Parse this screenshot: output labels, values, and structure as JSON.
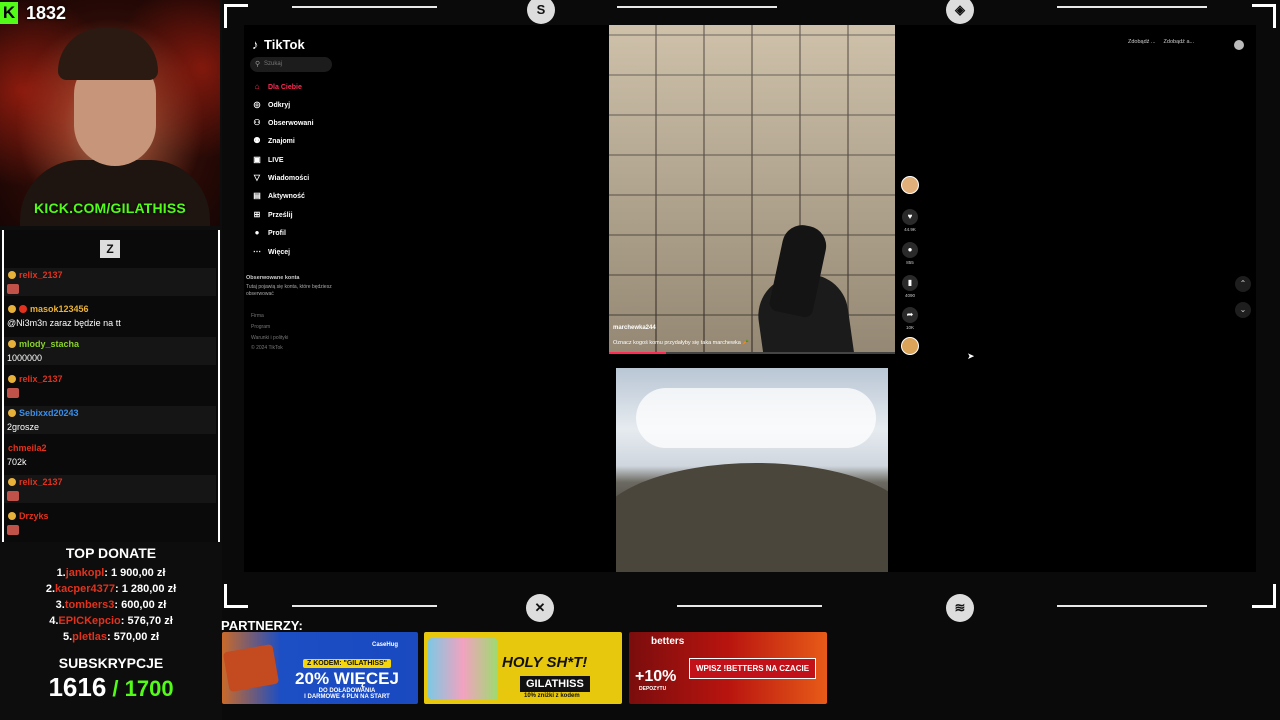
{
  "stream": {
    "viewer_count": "1832",
    "kick_url": "KICK.COM/GILATHISS"
  },
  "chat": {
    "messages": [
      {
        "user": "relix_2137",
        "text": "",
        "color": "#e2321d"
      },
      {
        "user": "masok123456",
        "text": "@Ni3m3n zaraz będzie na tt",
        "color": "#e8b13a"
      },
      {
        "user": "mlody_stacha",
        "text": "1000000",
        "color": "#8bd12b"
      },
      {
        "user": "relix_2137",
        "text": "",
        "color": "#e2321d"
      },
      {
        "user": "Sebixxd20243",
        "text": "2grosze",
        "color": "#3a8ee8"
      },
      {
        "user": "chmeila2",
        "text": "702k",
        "color": "#e2321d"
      },
      {
        "user": "relix_2137",
        "text": "",
        "color": "#e2321d"
      },
      {
        "user": "Drzyks",
        "text": "",
        "color": "#e2321d"
      }
    ]
  },
  "top_donate": {
    "title": "TOP DONATE",
    "donors": [
      {
        "rank": "1.",
        "name": "jankopl",
        "amount": ": 1 900,00 zł"
      },
      {
        "rank": "2.",
        "name": "kacper4377",
        "amount": ": 1 280,00 zł"
      },
      {
        "rank": "3.",
        "name": "tombers3",
        "amount": ": 600,00 zł"
      },
      {
        "rank": "4.",
        "name": "EPICKepcio",
        "amount": ": 576,70 zł"
      },
      {
        "rank": "5.",
        "name": "pletlas",
        "amount": ": 570,00 zł"
      }
    ]
  },
  "subs": {
    "title": "SUBSKRYPCJE",
    "current": "1616",
    "goal": " / 1700"
  },
  "tiktok": {
    "logo": "TikTok",
    "search_placeholder": "Szukaj",
    "nav": [
      {
        "label": "Dla Ciebie",
        "icon": "home-icon",
        "active": true
      },
      {
        "label": "Odkryj",
        "icon": "compass-icon"
      },
      {
        "label": "Obserwowani",
        "icon": "user-follow-icon"
      },
      {
        "label": "Znajomi",
        "icon": "friends-icon"
      },
      {
        "label": "LIVE",
        "icon": "live-icon"
      },
      {
        "label": "Wiadomości",
        "icon": "send-icon"
      },
      {
        "label": "Aktywność",
        "icon": "inbox-icon"
      },
      {
        "label": "Prześlij",
        "icon": "upload-icon"
      },
      {
        "label": "Profil",
        "icon": "avatar-icon"
      },
      {
        "label": "Więcej",
        "icon": "more-icon"
      }
    ],
    "followed_title": "Obserwowane konta",
    "followed_desc": "Tutaj pojawią się konta, które będziesz obserwować",
    "footer": [
      "Firma",
      "Program",
      "Warunki i polityki",
      "© 2024 TikTok"
    ],
    "video1": {
      "username": "marchewka244",
      "caption": "Oznacz kogoś komu przydałyby się taka marchewka 🥕"
    },
    "actions": {
      "likes": "44.9K",
      "comments": "855",
      "saves": "4090",
      "shares": "10K"
    },
    "topright": [
      "Zdobądź ...",
      "Zdobądź a..."
    ]
  },
  "partners": {
    "label": "PARTNERZY:",
    "banner1": {
      "code_label": "Z KODEM: \"GILATHISS\"",
      "big": "20% WIĘCEJ",
      "sub": "DO DOŁADOWANIA",
      "small": "I DARMOWE 4 PLN NA START",
      "brand": "CaseHug"
    },
    "banner2": {
      "headline": "HOLY SH*T!",
      "code": "GILATHISS",
      "promo": "10% zniżki z kodem"
    },
    "banner3": {
      "brand": "betters",
      "pct": "+10%",
      "dep": "DEPOZYTU",
      "cta": "WPISZ !BETTERS NA CZACIE"
    }
  },
  "colors": {
    "kick_green": "#53fc18",
    "tiktok_red": "#fe2c55",
    "donor_red": "#e2321d"
  }
}
